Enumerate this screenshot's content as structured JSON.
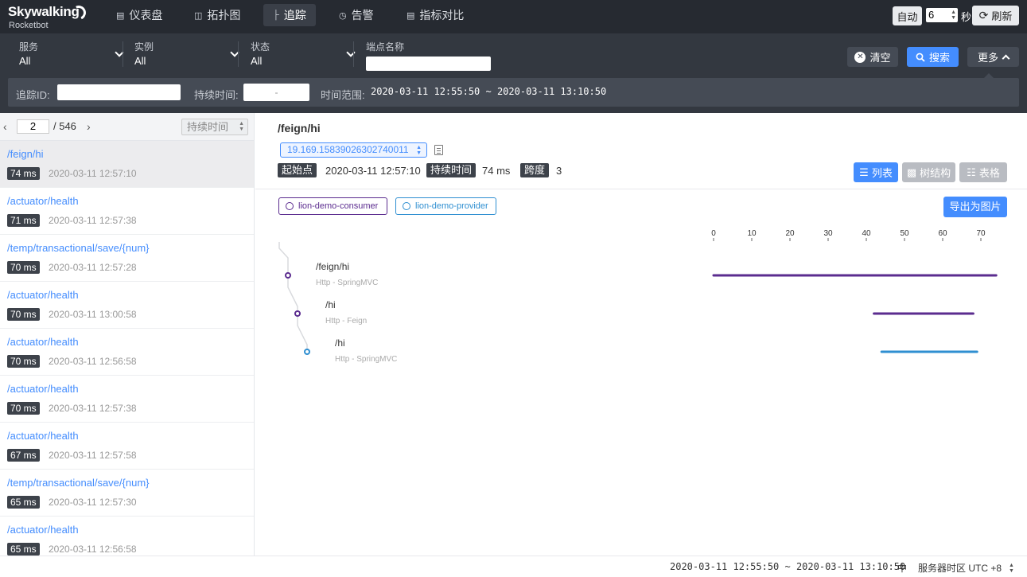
{
  "app": {
    "brand": "Skywalking",
    "sub": "Rocketbot"
  },
  "nav": [
    {
      "label": "仪表盘",
      "icon": "dashboard-icon"
    },
    {
      "label": "拓扑图",
      "icon": "topology-icon"
    },
    {
      "label": "追踪",
      "icon": "trace-icon"
    },
    {
      "label": "告警",
      "icon": "alarm-icon"
    },
    {
      "label": "指标对比",
      "icon": "comparison-icon"
    }
  ],
  "topbar": {
    "auto_label": "自动",
    "interval": "6",
    "unit": "秒",
    "refresh_label": "刷新"
  },
  "filters": {
    "service": {
      "label": "服务",
      "value": "All"
    },
    "instance": {
      "label": "实例",
      "value": "All"
    },
    "status": {
      "label": "状态",
      "value": "All"
    },
    "endpoint": {
      "label": "端点名称",
      "value": ""
    },
    "clear_label": "清空",
    "search_label": "搜索",
    "more_label": "更多"
  },
  "more": {
    "trace_id_label": "追踪ID:",
    "duration_label": "持续时间:",
    "duration_placeholder": "-",
    "time_label": "时间范围:",
    "time_value": "2020-03-11 12:55:50 ~ 2020-03-11 13:10:50"
  },
  "pager": {
    "page": "2",
    "total": "/ 546",
    "sort_label": "持续时间"
  },
  "traces": [
    {
      "endpoint": "/feign/hi",
      "duration": "74 ms",
      "time": "2020-03-11 12:57:10",
      "selected": true
    },
    {
      "endpoint": "/actuator/health",
      "duration": "71 ms",
      "time": "2020-03-11 12:57:38"
    },
    {
      "endpoint": "/temp/transactional/save/{num}",
      "duration": "70 ms",
      "time": "2020-03-11 12:57:28"
    },
    {
      "endpoint": "/actuator/health",
      "duration": "70 ms",
      "time": "2020-03-11 13:00:58"
    },
    {
      "endpoint": "/actuator/health",
      "duration": "70 ms",
      "time": "2020-03-11 12:56:58"
    },
    {
      "endpoint": "/actuator/health",
      "duration": "70 ms",
      "time": "2020-03-11 12:57:38"
    },
    {
      "endpoint": "/actuator/health",
      "duration": "67 ms",
      "time": "2020-03-11 12:57:58"
    },
    {
      "endpoint": "/temp/transactional/save/{num}",
      "duration": "65 ms",
      "time": "2020-03-11 12:57:30"
    },
    {
      "endpoint": "/actuator/health",
      "duration": "65 ms",
      "time": "2020-03-11 12:56:58"
    }
  ],
  "detail": {
    "title": "/feign/hi",
    "trace_id": "19.169.15839026302740011",
    "start_label": "起始点",
    "start_value": "2020-03-11 12:57:10",
    "duration_label": "持续时间",
    "duration_value": "74 ms",
    "span_label": "跨度",
    "span_value": "3",
    "view_list": "列表",
    "view_tree": "树结构",
    "view_table": "表格",
    "export_label": "导出为图片",
    "services": [
      {
        "name": "lion-demo-consumer",
        "color": "#5b2c8f"
      },
      {
        "name": "lion-demo-provider",
        "color": "#2f8fd1"
      }
    ],
    "axis_ticks": [
      0,
      10,
      20,
      30,
      40,
      50,
      60,
      70
    ],
    "spans": [
      {
        "name": "/feign/hi",
        "component": "Http - SpringMVC",
        "start": 0,
        "end": 74,
        "depth": 0,
        "service": 0
      },
      {
        "name": "/hi",
        "component": "Http - Feign",
        "start": 42,
        "end": 68,
        "depth": 1,
        "service": 0
      },
      {
        "name": "/hi",
        "component": "Http - SpringMVC",
        "start": 44,
        "end": 69,
        "depth": 2,
        "service": 1
      }
    ]
  },
  "footer": {
    "time_range": "2020-03-11 12:55:50 ~ 2020-03-11 13:10:50",
    "lang": "中",
    "timezone": "服务器时区 UTC +8"
  }
}
